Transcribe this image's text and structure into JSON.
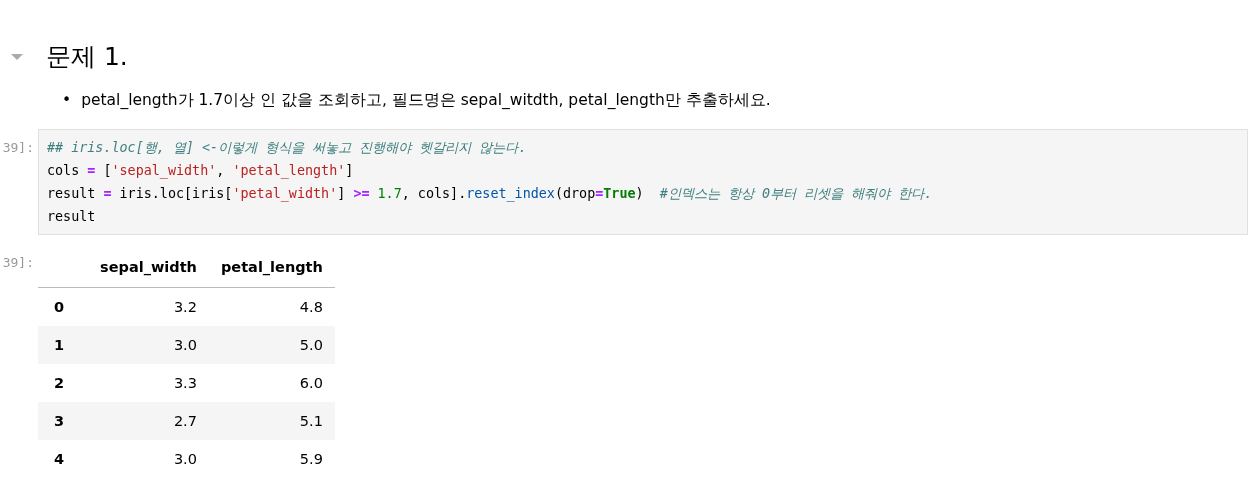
{
  "heading": {
    "text": "문제 1.",
    "expanded": true
  },
  "bullets": [
    {
      "marker": "•",
      "text": "petal_length가 1.7이상 인 값을 조회하고, 필드명은 sepal_witdth, petal_length만 추출하세요."
    }
  ],
  "input_cell": {
    "prompt": "39]:",
    "lines": [
      [
        {
          "kind": "comment",
          "text": "## iris.loc[행, 열] <-이렇게 형식을 써놓고 진행해야 헷갈리지 않는다."
        }
      ],
      [
        {
          "kind": "plain",
          "text": "cols "
        },
        {
          "kind": "operator",
          "text": "="
        },
        {
          "kind": "plain",
          "text": " ["
        },
        {
          "kind": "string",
          "text": "'sepal_width'"
        },
        {
          "kind": "plain",
          "text": ", "
        },
        {
          "kind": "string",
          "text": "'petal_length'"
        },
        {
          "kind": "plain",
          "text": "]"
        }
      ],
      [
        {
          "kind": "plain",
          "text": "result "
        },
        {
          "kind": "operator",
          "text": "="
        },
        {
          "kind": "plain",
          "text": " iris.loc[iris["
        },
        {
          "kind": "string",
          "text": "'petal_width'"
        },
        {
          "kind": "plain",
          "text": "] "
        },
        {
          "kind": "operator",
          "text": ">= "
        },
        {
          "kind": "number",
          "text": "1.7"
        },
        {
          "kind": "plain",
          "text": ", cols]."
        },
        {
          "kind": "function",
          "text": "reset_index"
        },
        {
          "kind": "plain",
          "text": "(drop"
        },
        {
          "kind": "operator",
          "text": "="
        },
        {
          "kind": "keyword",
          "text": "True"
        },
        {
          "kind": "plain",
          "text": ")  "
        },
        {
          "kind": "comment",
          "text": "#인덱스는 항상 0부터 리셋을 해줘야 한다."
        }
      ],
      [
        {
          "kind": "plain",
          "text": "result"
        }
      ]
    ]
  },
  "output_cell": {
    "prompt": "39]:",
    "table": {
      "columns": [
        "sepal_width",
        "petal_length"
      ],
      "rows": [
        {
          "index": "0",
          "cells": [
            "3.2",
            "4.8"
          ]
        },
        {
          "index": "1",
          "cells": [
            "3.0",
            "5.0"
          ]
        },
        {
          "index": "2",
          "cells": [
            "3.3",
            "6.0"
          ]
        },
        {
          "index": "3",
          "cells": [
            "2.7",
            "5.1"
          ]
        },
        {
          "index": "4",
          "cells": [
            "3.0",
            "5.9"
          ]
        }
      ]
    }
  }
}
